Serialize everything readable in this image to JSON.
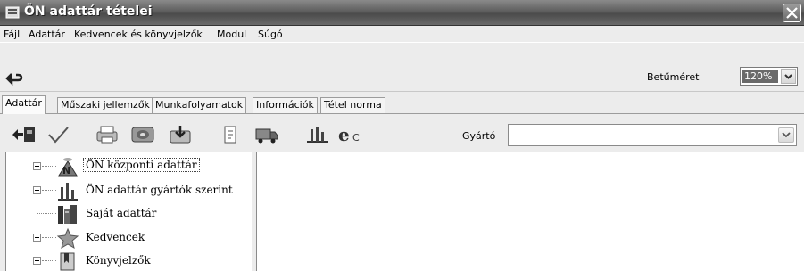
{
  "window": {
    "title": "ÖN adattár tételei"
  },
  "menu": [
    "Fájl",
    "Adattár",
    "Kedvencek és könyvjelzők",
    "Modul",
    "Súgó"
  ],
  "toolbar": {
    "fontsize_label": "Betűméret",
    "fontsize_value": "120%"
  },
  "tabs": [
    "Adattár",
    "Műszaki jellemzők",
    "Munkafolyamatok",
    "Információk",
    "Tétel norma"
  ],
  "filter": {
    "gyarto_label": "Gyártó",
    "gyarto_value": ""
  },
  "tree": {
    "items": [
      {
        "label": "ÖN központi adattár",
        "icon": "on-central-icon",
        "expandable": true,
        "selected": true
      },
      {
        "label": "ÖN adattár gyártók szerint",
        "icon": "factory-icon",
        "expandable": true,
        "selected": false
      },
      {
        "label": "Saját adattár",
        "icon": "books-icon",
        "expandable": false,
        "selected": false
      },
      {
        "label": "Kedvencek",
        "icon": "star-icon",
        "expandable": true,
        "selected": false
      },
      {
        "label": "Könyvjelzők",
        "icon": "bookmark-icon",
        "expandable": true,
        "selected": false
      }
    ]
  }
}
